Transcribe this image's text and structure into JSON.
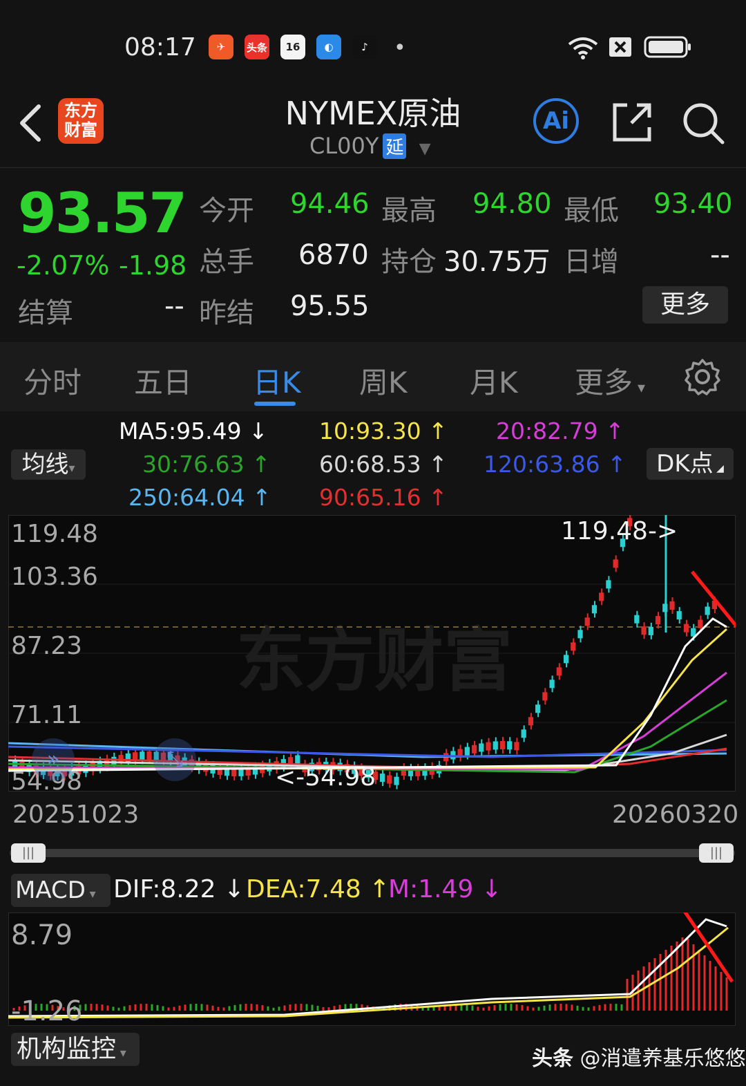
{
  "status": {
    "time": "08:17",
    "dot": "•",
    "apps": [
      {
        "name": "feishu-icon",
        "label": "✈",
        "color": "#f05a28"
      },
      {
        "name": "toutiao-icon",
        "label": "头条",
        "color": "#e8322b"
      },
      {
        "name": "calendar-icon",
        "label": "16",
        "color": "#f4f4f4"
      },
      {
        "name": "browser-icon",
        "label": "◐",
        "color": "#2b8ae8"
      },
      {
        "name": "douyin-icon",
        "label": "♪",
        "color": "#111111"
      }
    ]
  },
  "header": {
    "logo_line1": "东方",
    "logo_line2": "财富",
    "title": "NYMEX原油",
    "code": "CL00Y",
    "delay_badge": "延",
    "ai_label": "Ai"
  },
  "quote": {
    "price": "93.57",
    "pct": "-2.07%",
    "change": "-1.98",
    "open_label": "今开",
    "open": "94.46",
    "high_label": "最高",
    "high": "94.80",
    "low_label": "最低",
    "low": "93.40",
    "volume_label": "总手",
    "volume": "6870",
    "oi_label": "持仓",
    "oi": "30.75万",
    "daily_inc_label": "日增",
    "daily_inc": "--",
    "settle_label": "结算",
    "settle": "--",
    "prev_settle_label": "昨结",
    "prev_settle": "95.55",
    "more_label": "更多"
  },
  "tabs": [
    "分时",
    "五日",
    "日K",
    "周K",
    "月K",
    "更多"
  ],
  "ma": {
    "selector": "均线",
    "ma5": "MA5:95.49",
    "ma10": "10:93.30",
    "ma20": "20:82.79",
    "ma30": "30:76.63",
    "ma60": "60:68.53",
    "ma120": "120:63.86",
    "ma250": "250:64.04",
    "ma90": "90:65.16",
    "dk_label": "DK点",
    "colors": {
      "ma5": "#ffffff",
      "ma10": "#f5e44a",
      "ma20": "#d63fd6",
      "ma30": "#2aa52a",
      "ma60": "#d8d8d8",
      "ma120": "#3c58e8",
      "ma250": "#5ab6f0",
      "ma90": "#e03030"
    }
  },
  "chart": {
    "y_labels": [
      "119.48",
      "103.36",
      "87.23",
      "71.11",
      "54.98"
    ],
    "high_marker": "119.48->",
    "low_marker": "<-54.98",
    "date_start": "20251023",
    "date_end": "20260320",
    "watermark": "东方财富"
  },
  "macd": {
    "selector": "MACD",
    "dif": "DIF:8.22",
    "dea": "DEA:7.48",
    "m": "M:1.49",
    "y_top": "8.79",
    "y_bottom": "-1.26"
  },
  "footer": {
    "selector": "机构监控",
    "credit_prefix": "头条",
    "credit": "@消遣养基乐悠悠"
  }
}
